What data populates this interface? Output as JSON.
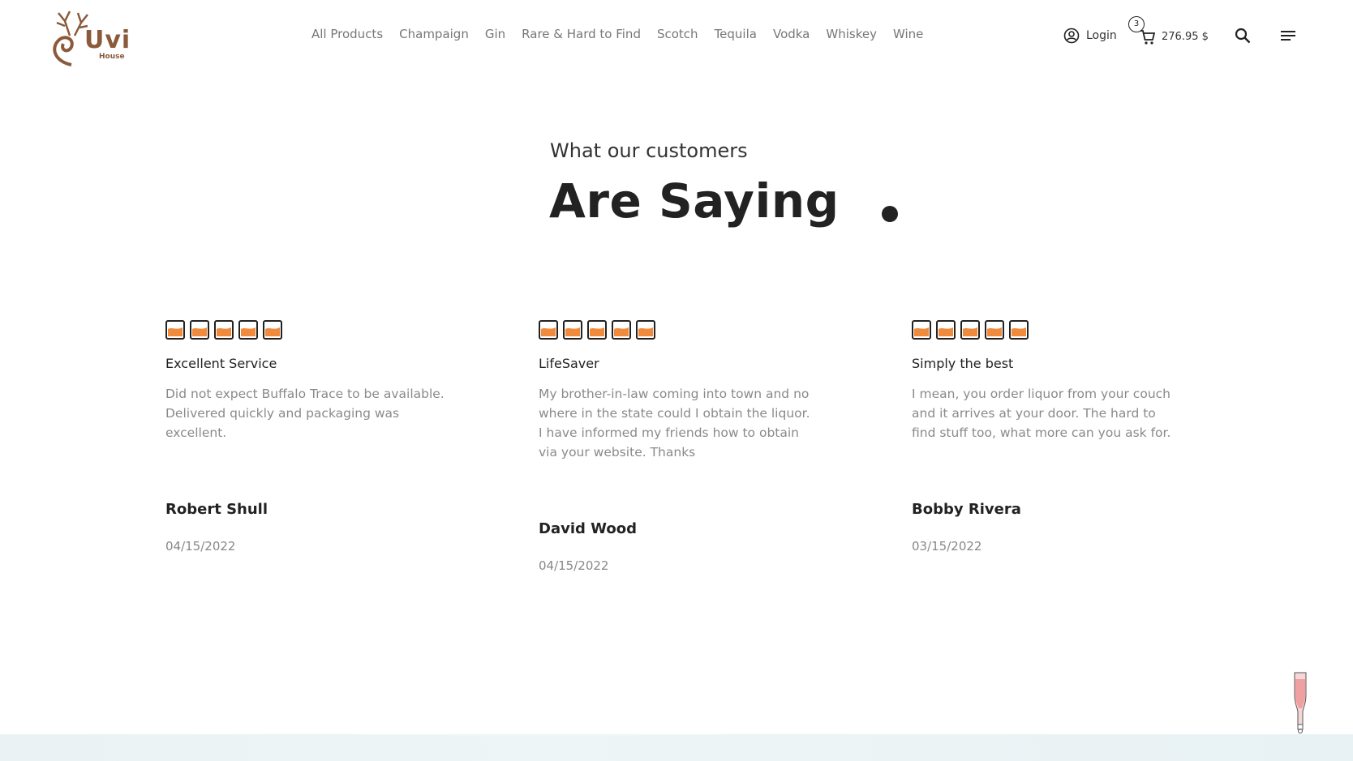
{
  "header": {
    "logo_text": "Uvi",
    "logo_sub": "House",
    "nav": [
      "All Products",
      "Champaign",
      "Gin",
      "Rare & Hard to Find",
      "Scotch",
      "Tequila",
      "Vodka",
      "Whiskey",
      "Wine"
    ],
    "login_label": "Login",
    "cart_count": "3",
    "cart_total": "276.95 $",
    "icons": {
      "login": "user-circle-icon",
      "cart": "cart-icon",
      "search": "search-icon",
      "menu": "menu-icon"
    }
  },
  "section": {
    "subtitle": "What our customers",
    "title": "Are Saying"
  },
  "reviews": [
    {
      "rating": 5,
      "title": "Excellent Service",
      "text": "Did not expect Buffalo Trace to be available. Delivered quickly and packaging was excellent.",
      "name": "Robert Shull",
      "date": "04/15/2022"
    },
    {
      "rating": 5,
      "title": "LifeSaver",
      "text": "My brother-in-law coming into town and no where in the state could I obtain the liquor. I have informed my friends how to obtain via your website. Thanks",
      "name": "David Wood",
      "date": "04/15/2022"
    },
    {
      "rating": 5,
      "title": "Simply the best",
      "text": "I mean, you order liquor from your couch and it arrives at your door. The hard to find stuff too, what more can you ask for.",
      "name": "Bobby Rivera",
      "date": "03/15/2022"
    }
  ],
  "colors": {
    "accent": "#f08a3c",
    "brand": "#8a5a3a",
    "text": "#222222",
    "muted": "#8a8a8a"
  }
}
